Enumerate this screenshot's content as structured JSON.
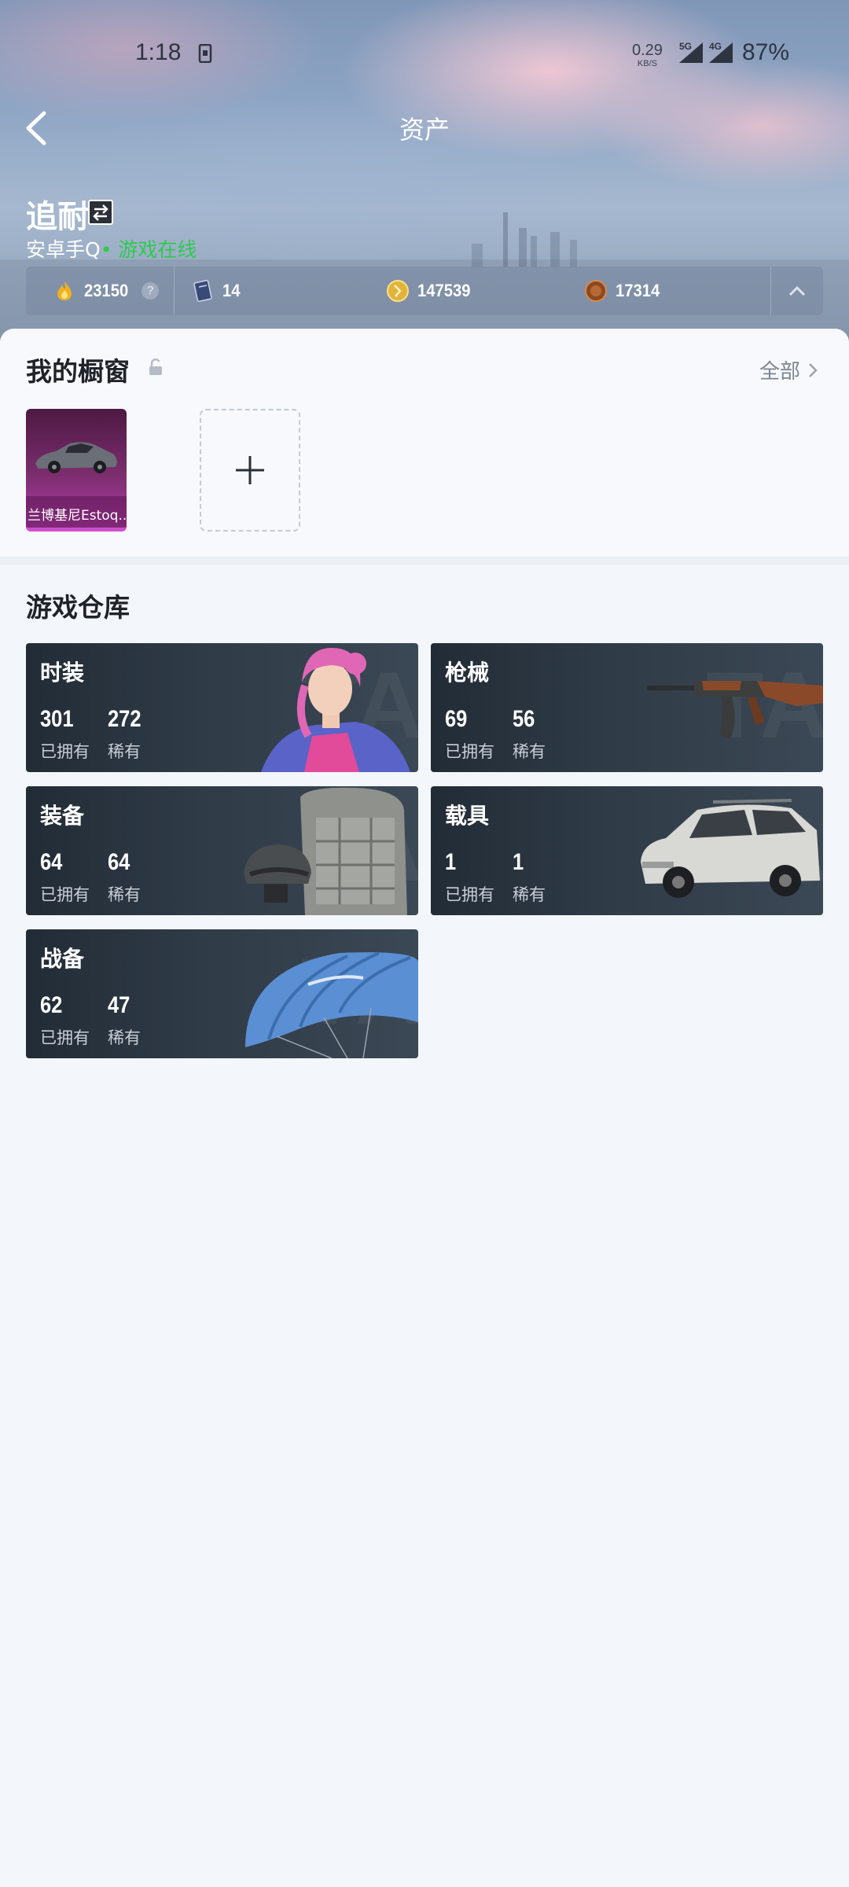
{
  "status_bar": {
    "time": "1:18",
    "net_speed_value": "0.29",
    "net_speed_unit": "KB/S",
    "signal_1": "5G",
    "signal_2": "4G",
    "battery": "87%"
  },
  "header": {
    "title": "资产",
    "back_icon": "chevron-left-icon"
  },
  "profile": {
    "name": "追耐",
    "platform": "安卓手Q",
    "status": "• 游戏在线",
    "status_color": "#2ec94f"
  },
  "currencies": [
    {
      "icon": "flame-coin-icon",
      "value": "23150",
      "has_help": true
    },
    {
      "icon": "book-icon",
      "value": "14"
    },
    {
      "icon": "gold-coin-icon",
      "value": "147539"
    },
    {
      "icon": "bronze-coin-icon",
      "value": "17314"
    }
  ],
  "currency_help_glyph": "?",
  "showcase": {
    "title": "我的橱窗",
    "all_label": "全部",
    "items": [
      {
        "name": "兰博基尼Estoq...",
        "rarity_color": "#d04fcf"
      }
    ]
  },
  "warehouse": {
    "title": "游戏仓库",
    "owned_label": "已拥有",
    "rare_label": "稀有",
    "categories": [
      {
        "name": "时装",
        "owned": "301",
        "rare": "272"
      },
      {
        "name": "枪械",
        "owned": "69",
        "rare": "56"
      },
      {
        "name": "装备",
        "owned": "64",
        "rare": "64"
      },
      {
        "name": "载具",
        "owned": "1",
        "rare": "1"
      },
      {
        "name": "战备",
        "owned": "62",
        "rare": "47"
      }
    ]
  }
}
